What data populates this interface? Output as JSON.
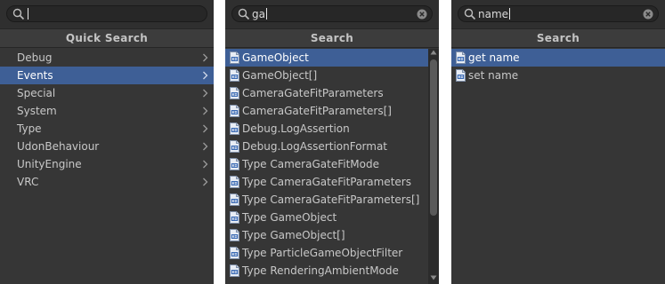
{
  "panels": [
    {
      "search": {
        "value": ""
      },
      "header": "Quick Search",
      "items": [
        {
          "label": "Debug",
          "selected": false
        },
        {
          "label": "Events",
          "selected": true
        },
        {
          "label": "Special",
          "selected": false
        },
        {
          "label": "System",
          "selected": false
        },
        {
          "label": "Type",
          "selected": false
        },
        {
          "label": "UdonBehaviour",
          "selected": false
        },
        {
          "label": "UnityEngine",
          "selected": false
        },
        {
          "label": "VRC",
          "selected": false
        }
      ]
    },
    {
      "search": {
        "value": "ga"
      },
      "header": "Search",
      "items": [
        {
          "label": "GameObject",
          "selected": true
        },
        {
          "label": "GameObject[]",
          "selected": false
        },
        {
          "label": "CameraGateFitParameters",
          "selected": false
        },
        {
          "label": "CameraGateFitParameters[]",
          "selected": false
        },
        {
          "label": "Debug.LogAssertion",
          "selected": false
        },
        {
          "label": "Debug.LogAssertionFormat",
          "selected": false
        },
        {
          "label": "Type CameraGateFitMode",
          "selected": false
        },
        {
          "label": "Type CameraGateFitParameters",
          "selected": false
        },
        {
          "label": "Type CameraGateFitParameters[]",
          "selected": false
        },
        {
          "label": "Type GameObject",
          "selected": false
        },
        {
          "label": "Type GameObject[]",
          "selected": false
        },
        {
          "label": "Type ParticleGameObjectFilter",
          "selected": false
        },
        {
          "label": "Type RenderingAmbientMode",
          "selected": false
        }
      ]
    },
    {
      "search": {
        "value": "name"
      },
      "header": "Search",
      "items": [
        {
          "label": "get name",
          "selected": true
        },
        {
          "label": "set name",
          "selected": false
        }
      ]
    }
  ],
  "colors": {
    "panel_bg": "#363636",
    "selection": "#3e5f96",
    "text": "#c8c8c8"
  },
  "icons": {
    "search": "search-icon",
    "clear": "clear-search-icon",
    "category_arrow": "chevron-right-icon",
    "item": "csharp-file-icon"
  }
}
